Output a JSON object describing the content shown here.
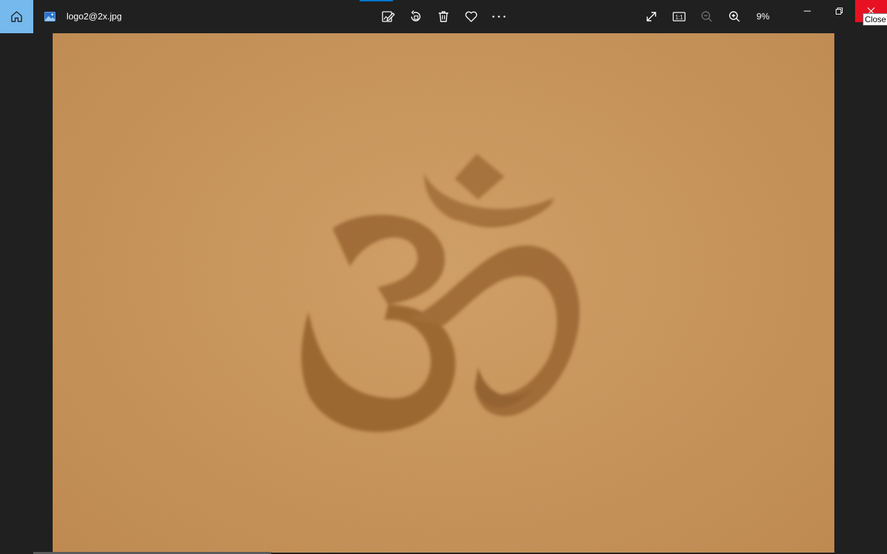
{
  "window": {
    "file_name": "logo2@2x.jpg",
    "zoom_level": "9%",
    "actual_size_label": "1:1",
    "close_tooltip": "Close"
  },
  "toolbar": {
    "icons": [
      "edit-image-icon",
      "rotate-icon",
      "delete-icon",
      "favorite-icon",
      "more-options-icon"
    ]
  },
  "view_controls": {
    "icons": [
      "full-screen-icon",
      "actual-size-icon",
      "zoom-out-icon",
      "zoom-in-icon"
    ]
  },
  "photo": {
    "subject": "om symbol in sand",
    "colors": {
      "sand": "#cf9a5e",
      "groove": "#8a5a2a"
    }
  },
  "colors": {
    "background": "#202020",
    "home_accent": "#76b9ed",
    "close_red": "#e81123",
    "tab_accent": "#0078d4"
  }
}
